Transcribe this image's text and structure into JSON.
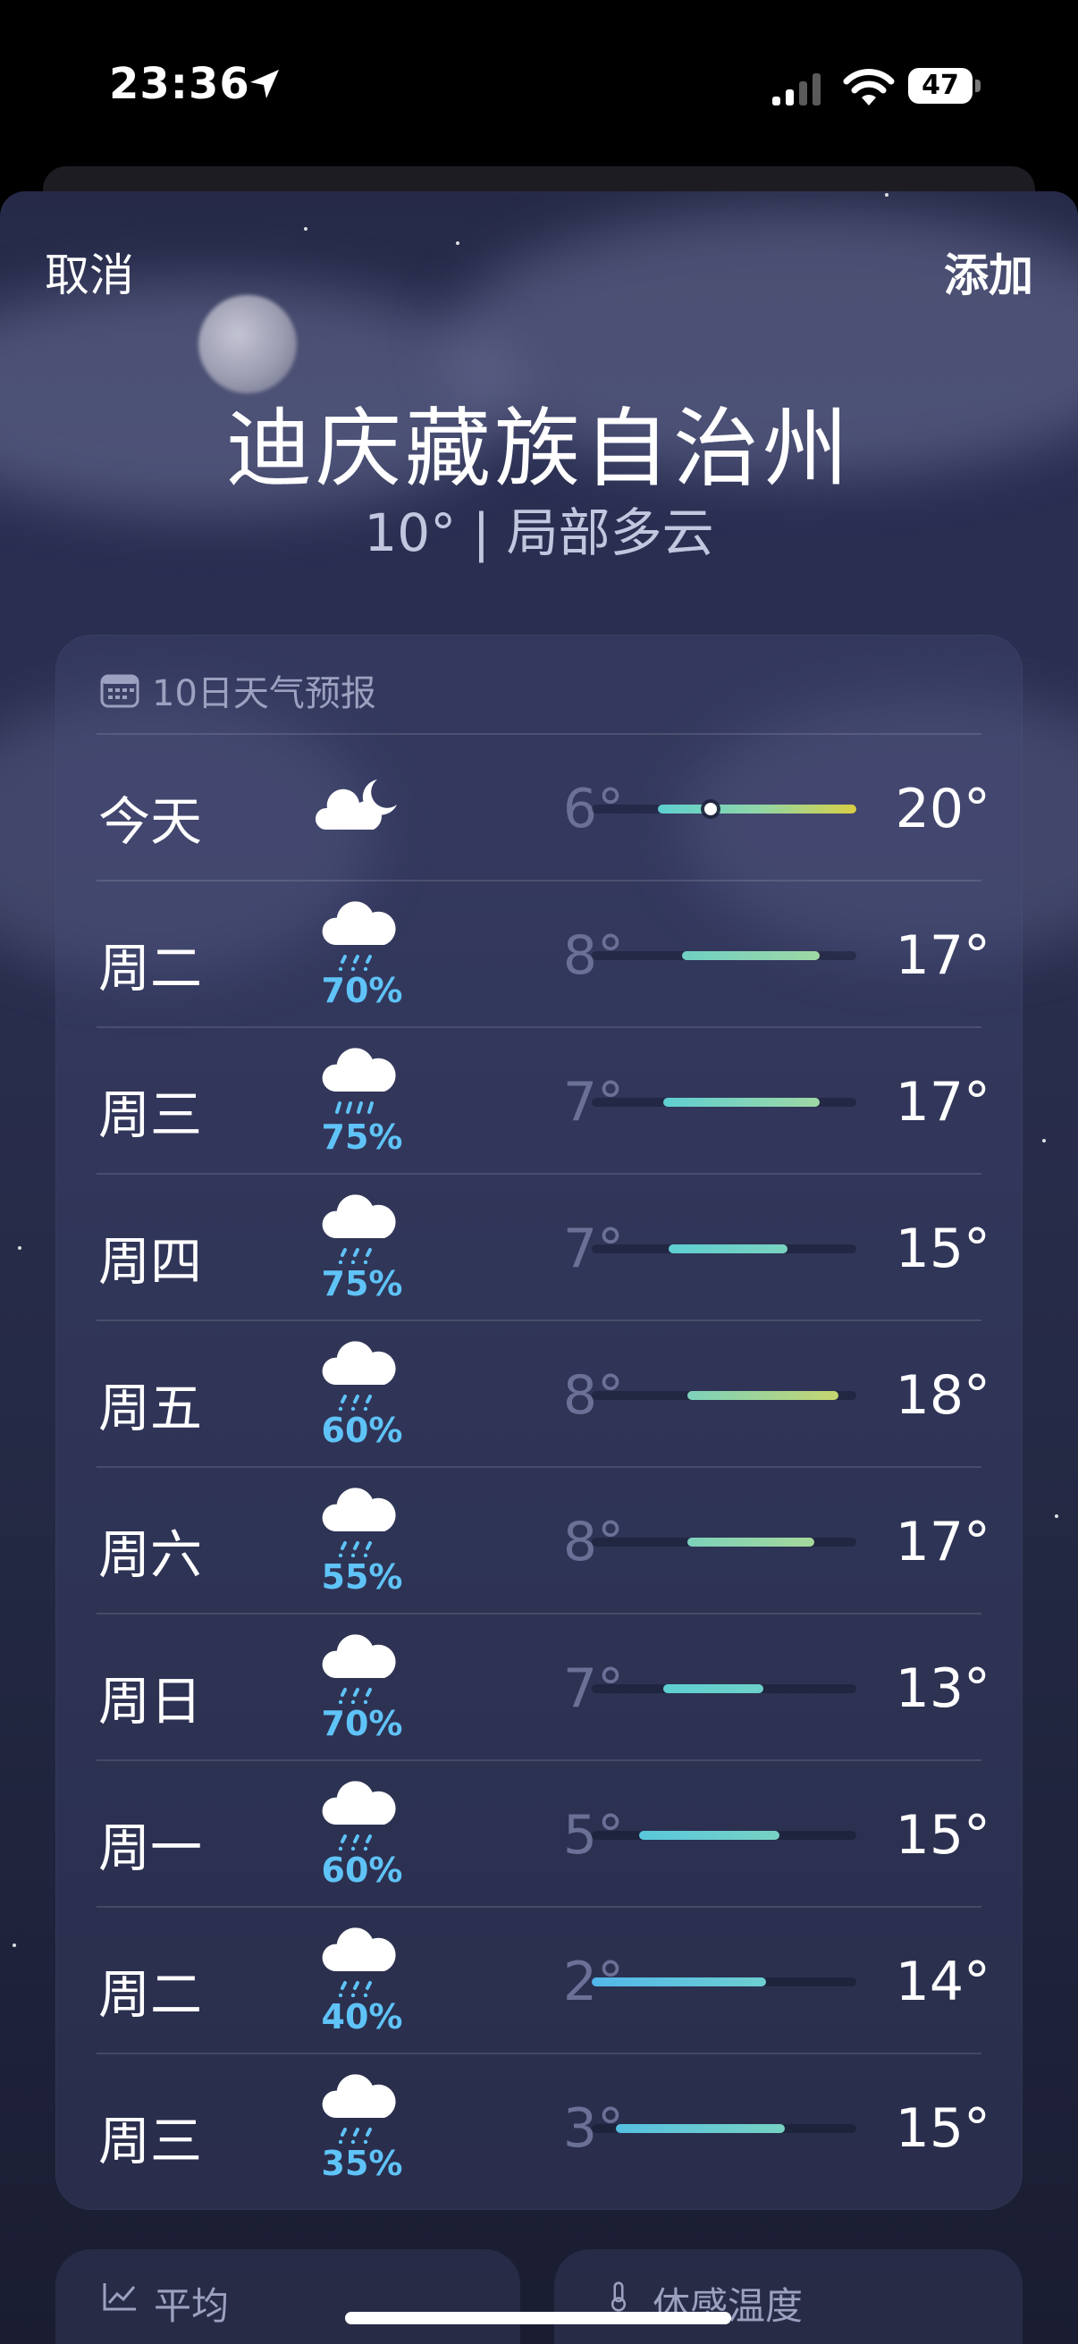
{
  "status_bar": {
    "time": "23:36",
    "battery": "47"
  },
  "header": {
    "cancel_label": "取消",
    "add_label": "添加",
    "city": "迪庆藏族自治州",
    "current_summary": "10° | 局部多云"
  },
  "forecast": {
    "title": "10日天气预报",
    "icon": "calendar-icon",
    "days": [
      {
        "day": "今天",
        "icon": "partly-cloudy-night-icon",
        "precip": "",
        "low": "6°",
        "high": "20°",
        "range_start": 0.25,
        "range_end": 1.0,
        "current_marker": 0.45,
        "colors": [
          "#5dcfd0",
          "#8fd6a8",
          "#d9cf45"
        ]
      },
      {
        "day": "周二",
        "icon": "rain-cloud-icon",
        "precip": "70%",
        "low": "8°",
        "high": "17°",
        "range_start": 0.34,
        "range_end": 0.86,
        "colors": [
          "#6fd0c3",
          "#9fd8a4"
        ]
      },
      {
        "day": "周三",
        "icon": "heavy-rain-cloud-icon",
        "precip": "75%",
        "low": "7°",
        "high": "17°",
        "range_start": 0.27,
        "range_end": 0.86,
        "colors": [
          "#5fcfd2",
          "#9fd8a4"
        ]
      },
      {
        "day": "周四",
        "icon": "rain-cloud-icon",
        "precip": "75%",
        "low": "7°",
        "high": "15°",
        "range_start": 0.29,
        "range_end": 0.74,
        "colors": [
          "#5fcfd2",
          "#79d2bf"
        ]
      },
      {
        "day": "周五",
        "icon": "rain-cloud-icon",
        "precip": "60%",
        "low": "8°",
        "high": "18°",
        "range_start": 0.36,
        "range_end": 0.93,
        "colors": [
          "#7cd2bb",
          "#c6d670"
        ]
      },
      {
        "day": "周六",
        "icon": "rain-cloud-icon",
        "precip": "55%",
        "low": "8°",
        "high": "17°",
        "range_start": 0.36,
        "range_end": 0.84,
        "colors": [
          "#7cd2bb",
          "#a6d89a"
        ]
      },
      {
        "day": "周日",
        "icon": "rain-cloud-icon",
        "precip": "70%",
        "low": "7°",
        "high": "13°",
        "range_start": 0.27,
        "range_end": 0.65,
        "colors": [
          "#5fcfd2",
          "#6dd1c8"
        ]
      },
      {
        "day": "周一",
        "icon": "rain-cloud-icon",
        "precip": "60%",
        "low": "5°",
        "high": "15°",
        "range_start": 0.18,
        "range_end": 0.71,
        "colors": [
          "#59c8dc",
          "#77d2c3"
        ]
      },
      {
        "day": "周二",
        "icon": "rain-cloud-icon",
        "precip": "40%",
        "low": "2°",
        "high": "14°",
        "range_start": 0.0,
        "range_end": 0.66,
        "colors": [
          "#52b7ea",
          "#6dcfd0"
        ]
      },
      {
        "day": "周三",
        "icon": "rain-cloud-icon",
        "precip": "35%",
        "low": "3°",
        "high": "15°",
        "range_start": 0.09,
        "range_end": 0.73,
        "colors": [
          "#56c0e2",
          "#77d2c3"
        ]
      }
    ]
  },
  "tiles": [
    {
      "label": "平均",
      "icon": "chart-line-icon"
    },
    {
      "label": "体感温度",
      "icon": "thermometer-icon"
    }
  ]
}
